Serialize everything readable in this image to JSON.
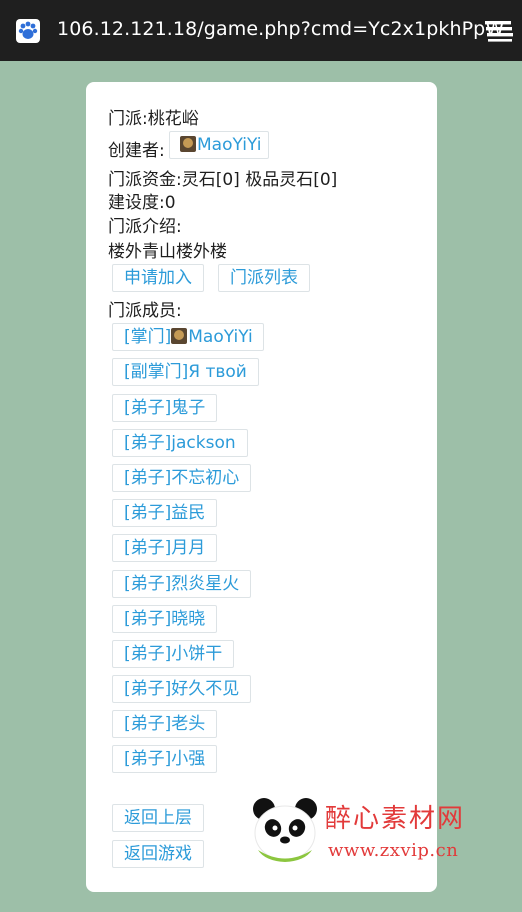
{
  "browser": {
    "url": "106.12.121.18/game.php?cmd=Yc2x1pkhPpW"
  },
  "sect": {
    "name_line": "门派:桃花峪",
    "creator_label": "创建者:",
    "creator_name": "MaoYiYi",
    "funds_line": "门派资金:灵石[0] 极品灵石[0]",
    "construction_line": "建设度:0",
    "intro_label": "门派介绍:",
    "intro_text": "楼外青山楼外楼",
    "join_button": "申请加入",
    "list_button": "门派列表",
    "members_label": "门派成员:",
    "leader": {
      "role": "[掌门]",
      "name": "MaoYiYi"
    },
    "members": [
      "[副掌门]Я твой",
      "[弟子]鬼子",
      "[弟子]jackson",
      "[弟子]不忘初心",
      "[弟子]益民",
      "[弟子]月月",
      "[弟子]烈炎星火",
      "[弟子]晓晓",
      "[弟子]小饼干",
      "[弟子]好久不见",
      "[弟子]老头",
      "[弟子]小强"
    ],
    "back_button": "返回上层",
    "game_button": "返回游戏"
  },
  "watermark": {
    "title": "醉心素材网",
    "url": "www.zxvip.cn"
  },
  "colors": {
    "page_bg": "#9dbfa8",
    "link": "#2c9bd9",
    "topbar": "#1f1f1f"
  }
}
